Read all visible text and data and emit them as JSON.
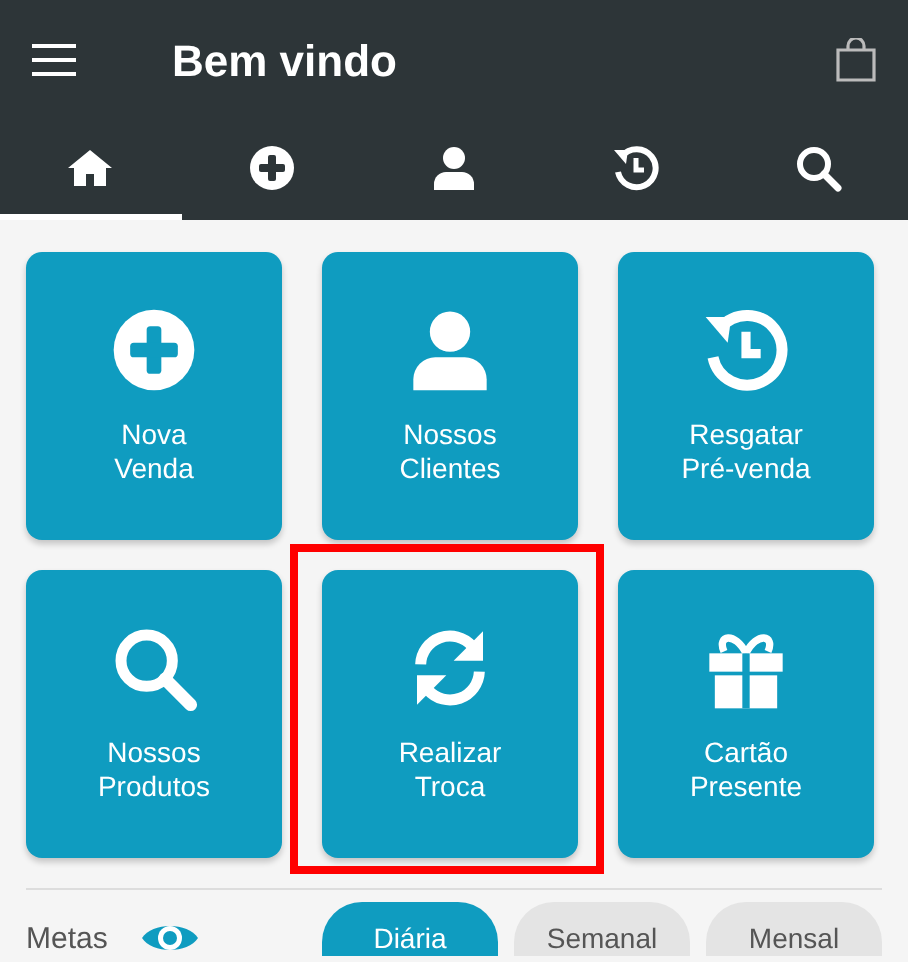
{
  "app_bar": {
    "title": "Bem vindo"
  },
  "tabs": [
    {
      "selected": true
    },
    {
      "selected": false
    },
    {
      "selected": false
    },
    {
      "selected": false
    },
    {
      "selected": false
    }
  ],
  "tiles": [
    {
      "label": "Nova\nVenda",
      "highlighted": false
    },
    {
      "label": "Nossos\nClientes",
      "highlighted": false
    },
    {
      "label": "Resgatar\nPré-venda",
      "highlighted": false
    },
    {
      "label": "Nossos\nProdutos",
      "highlighted": false
    },
    {
      "label": "Realizar\nTroca",
      "highlighted": true
    },
    {
      "label": "Cartão\nPresente",
      "highlighted": false
    }
  ],
  "goals": {
    "label": "Metas",
    "periods": [
      {
        "label": "Diária",
        "selected": true
      },
      {
        "label": "Semanal",
        "selected": false
      },
      {
        "label": "Mensal",
        "selected": false
      }
    ]
  }
}
